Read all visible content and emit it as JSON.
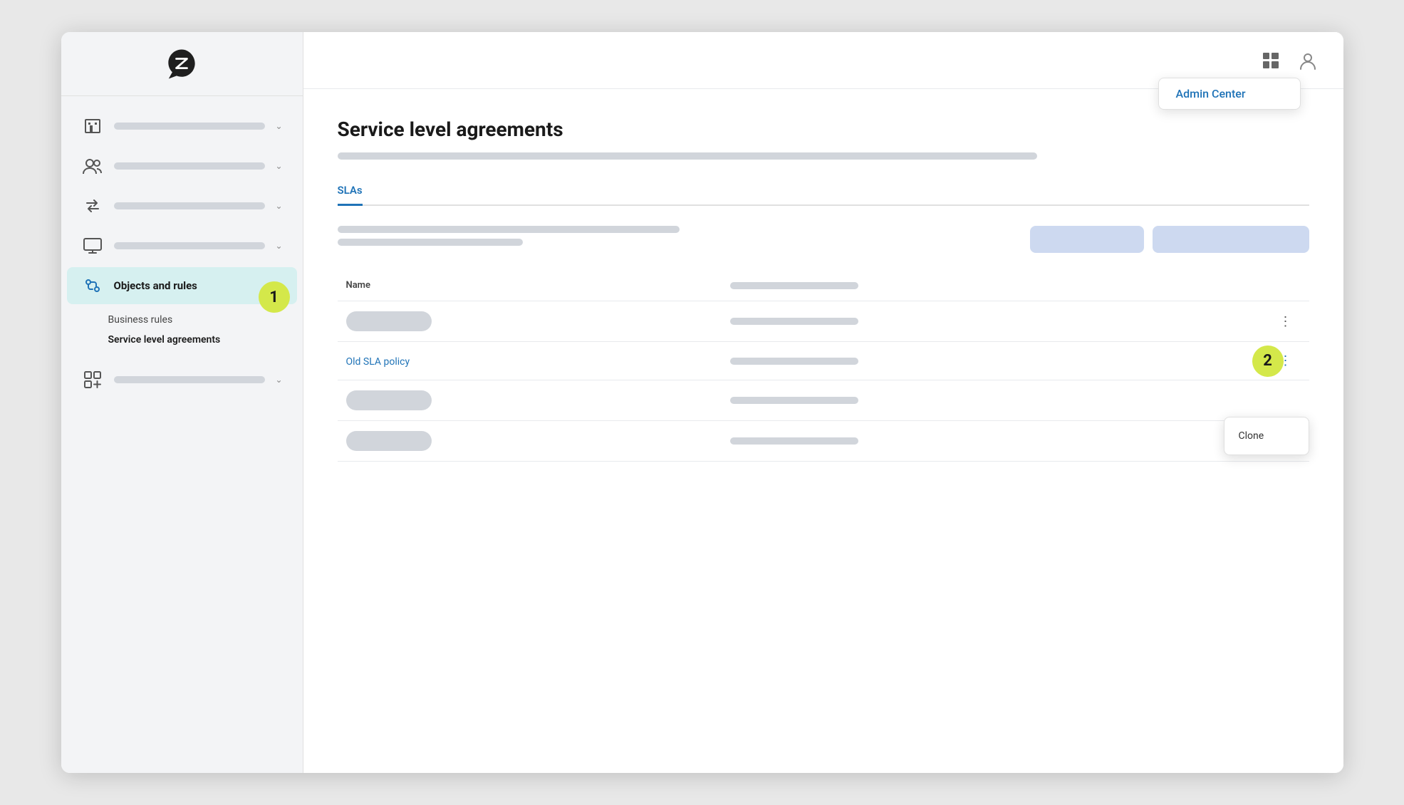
{
  "sidebar": {
    "logo_alt": "Zendesk logo",
    "nav_items": [
      {
        "id": "organization",
        "icon": "building",
        "active": false,
        "has_submenu": true
      },
      {
        "id": "people",
        "icon": "people",
        "active": false,
        "has_submenu": true
      },
      {
        "id": "channels",
        "icon": "arrows",
        "active": false,
        "has_submenu": true
      },
      {
        "id": "workspace",
        "icon": "monitor",
        "active": false,
        "has_submenu": true
      },
      {
        "id": "objects-rules",
        "icon": "objects",
        "label": "Objects and rules",
        "active": true,
        "has_submenu": true,
        "sub_items": [
          {
            "id": "business-rules",
            "label": "Business rules",
            "active": false
          },
          {
            "id": "service-level-agreements",
            "label": "Service level agreements",
            "active": true
          }
        ]
      },
      {
        "id": "marketplace",
        "icon": "marketplace",
        "active": false,
        "has_submenu": true
      }
    ]
  },
  "topbar": {
    "grid_icon_alt": "apps grid",
    "person_icon_alt": "user profile",
    "admin_dropdown": {
      "visible": true,
      "label": "Admin Center"
    }
  },
  "main": {
    "title": "Service level agreements",
    "tabs": [
      {
        "id": "slas",
        "label": "SLAs",
        "active": true
      }
    ],
    "table": {
      "name_col": "Name",
      "rows": [
        {
          "id": "row1",
          "name": null,
          "is_link": false,
          "has_menu": true
        },
        {
          "id": "row2",
          "name": "Old SLA policy",
          "is_link": true,
          "has_menu": true,
          "menu_open": true
        },
        {
          "id": "row3",
          "name": null,
          "is_link": false,
          "has_menu": false
        },
        {
          "id": "row4",
          "name": null,
          "is_link": false,
          "has_menu": true
        }
      ]
    },
    "clone_menu": {
      "visible": true,
      "label": "Clone"
    }
  },
  "badges": [
    {
      "id": "badge-1",
      "number": "1"
    },
    {
      "id": "badge-2",
      "number": "2"
    }
  ]
}
